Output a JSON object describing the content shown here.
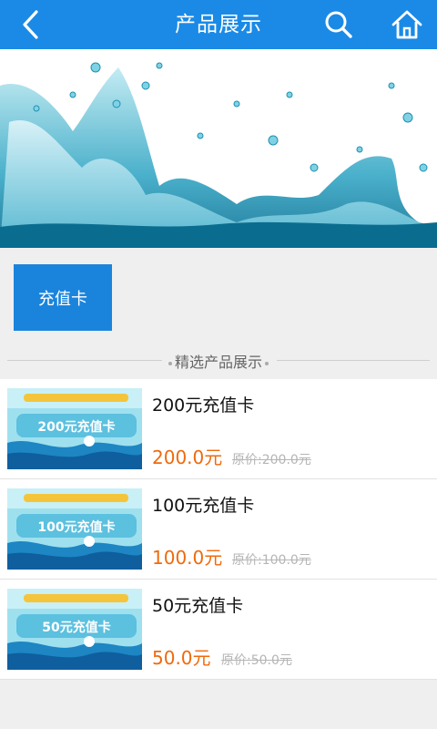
{
  "header": {
    "title": "产品展示",
    "back_icon": "chevron-left-icon",
    "search_icon": "search-icon",
    "home_icon": "home-icon",
    "bar_color": "#1a8ae6"
  },
  "banner": {
    "image": "water-splash-image"
  },
  "category": {
    "button_label": "充值卡",
    "button_color": "#1a84dd"
  },
  "section": {
    "title": "精选产品展示"
  },
  "products": [
    {
      "name": "200元充值卡",
      "price": "200.0元",
      "original_price": "原价:200.0元",
      "card_text": "200元充值卡"
    },
    {
      "name": "100元充值卡",
      "price": "100.0元",
      "original_price": "原价:100.0元",
      "card_text": "100元充值卡"
    },
    {
      "name": "50元充值卡",
      "price": "50.0元",
      "original_price": "原价:50.0元",
      "card_text": "50元充值卡"
    }
  ],
  "colors": {
    "price": "#ef6a0c",
    "original_price": "#b5b5b5"
  }
}
